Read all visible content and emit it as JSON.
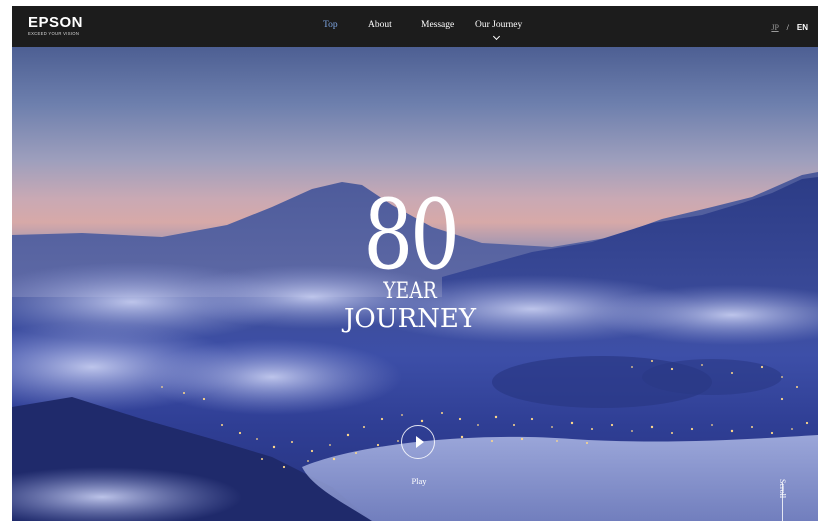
{
  "brand": {
    "name": "EPSON",
    "tagline": "EXCEED YOUR VISION"
  },
  "nav": {
    "items": [
      {
        "label": "Top",
        "active": true
      },
      {
        "label": "About"
      },
      {
        "label": "Message"
      },
      {
        "label": "Our Journey",
        "has_dropdown": true
      }
    ]
  },
  "language": {
    "jp": "JP",
    "separator": "/",
    "en": "EN",
    "selected": "EN"
  },
  "hero": {
    "number": "80",
    "line1": "YEAR",
    "line2": "JOURNEY",
    "play_label": "Play",
    "scroll_label": "Scroll"
  },
  "colors": {
    "header_bg": "#1c1c1c",
    "nav_active": "#7fa7e6",
    "sky_top": "#4d5f93",
    "horizon": "#d7a9a8",
    "clouds": "#3d4fa8"
  }
}
